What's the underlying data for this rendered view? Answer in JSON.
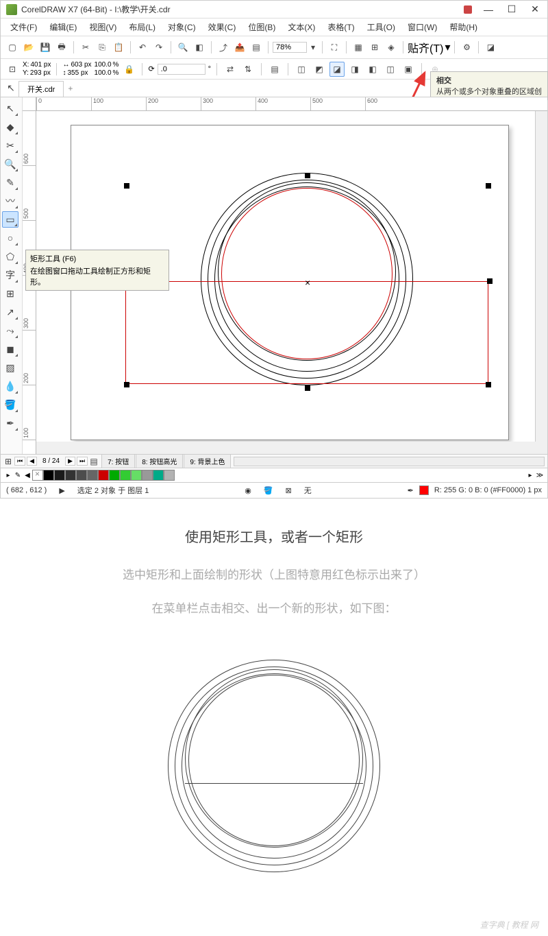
{
  "title": "CorelDRAW X7 (64-Bit) - I:\\教学\\开关.cdr",
  "menus": [
    "文件(F)",
    "编辑(E)",
    "视图(V)",
    "布局(L)",
    "对象(C)",
    "效果(C)",
    "位图(B)",
    "文本(X)",
    "表格(T)",
    "工具(O)",
    "窗口(W)",
    "帮助(H)"
  ],
  "zoom": "78%",
  "snap_label": "贴齐(T)",
  "coord": {
    "x_label": "X:",
    "x": "401 px",
    "y_label": "Y:",
    "y": "293 px"
  },
  "dims": {
    "w": "603 px",
    "h": "355 px"
  },
  "scale": {
    "s1": "100.0",
    "s2": "100.0",
    "unit": "%"
  },
  "angle": ".0",
  "angle_unit": "°",
  "tooltip_intersect": {
    "title": "相交",
    "desc": "从两个或多个对象重叠的区域创"
  },
  "doc_tab": "开关.cdr",
  "tool_tooltip": {
    "title": "矩形工具 (F6)",
    "desc": "在绘图窗口拖动工具绘制正方形和矩形。"
  },
  "ruler_h": [
    "0",
    "100",
    "200",
    "300",
    "400",
    "500",
    "600"
  ],
  "ruler_v": [
    "600",
    "500",
    "400",
    "300",
    "200",
    "100"
  ],
  "page_counter": "8 / 24",
  "page_tabs": [
    "7: 按钮",
    "8: 按钮高光",
    "9: 背景上色"
  ],
  "status": {
    "mouse": "( 682 , 612 )",
    "selection": "选定 2 对象 于 图层 1",
    "fill_none": "无",
    "color_info": "R: 255 G: 0 B: 0 (#FF0000) 1 px"
  },
  "palette_colors": [
    "#000000",
    "#1a1a1a",
    "#333333",
    "#4d4d4d",
    "#666666",
    "#cc0000",
    "#00aa00",
    "#33cc33",
    "#66dd66",
    "#999999",
    "#00aa88",
    "#b3b3b3"
  ],
  "instructions": {
    "main": "使用矩形工具，或者一个矩形",
    "sub1": "选中矩形和上面绘制的形状（上图特意用红色标示出来了）",
    "sub2": "在菜单栏点击相交、出一个新的形状，如下图："
  },
  "watermark": "查字典 [ 教程 网"
}
